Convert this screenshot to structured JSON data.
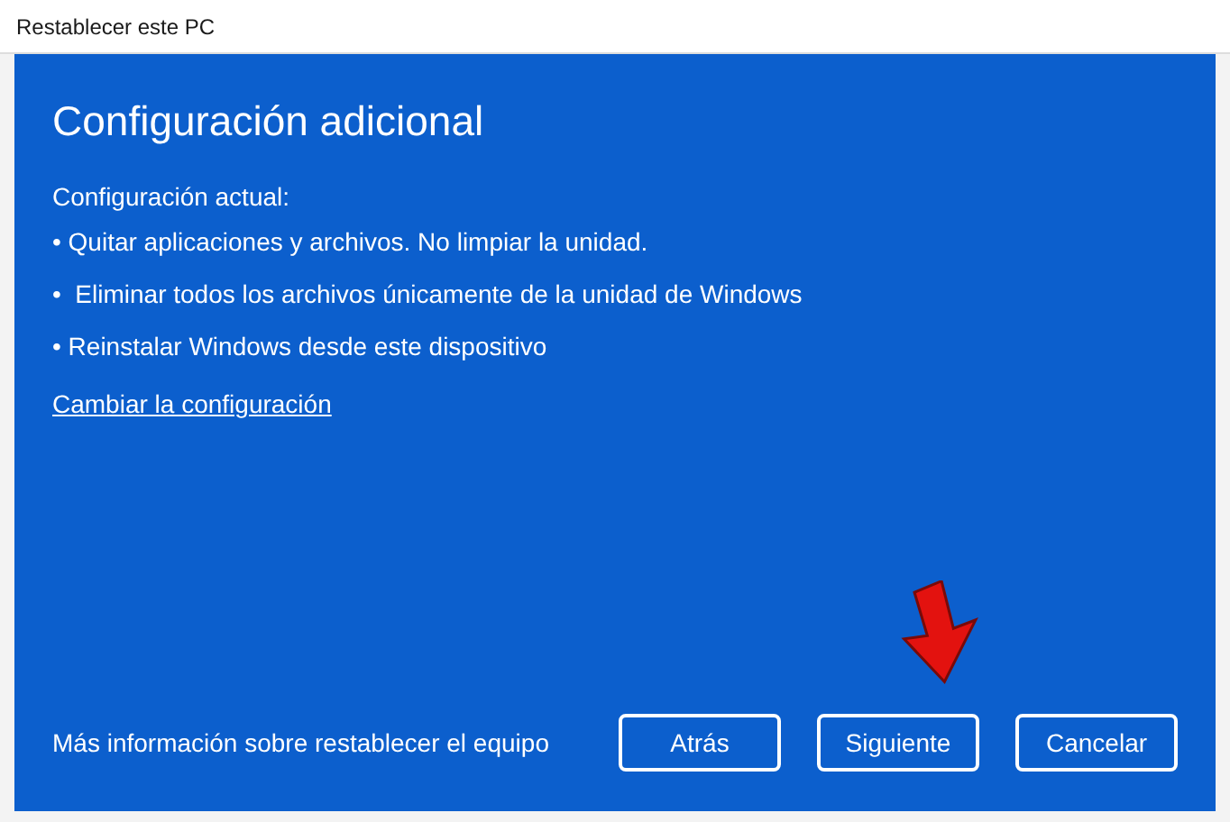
{
  "window": {
    "title": "Restablecer este PC"
  },
  "heading": "Configuración adicional",
  "section_label": "Configuración actual:",
  "settings": [
    "• Quitar aplicaciones y archivos. No limpiar la unidad.",
    "•  Eliminar todos los archivos únicamente de la unidad de Windows",
    "• Reinstalar Windows desde este dispositivo"
  ],
  "change_link": "Cambiar la configuración",
  "footer": {
    "info_link": "Más información sobre restablecer el equipo",
    "buttons": [
      "Atrás",
      "Siguiente",
      "Cancelar"
    ]
  }
}
